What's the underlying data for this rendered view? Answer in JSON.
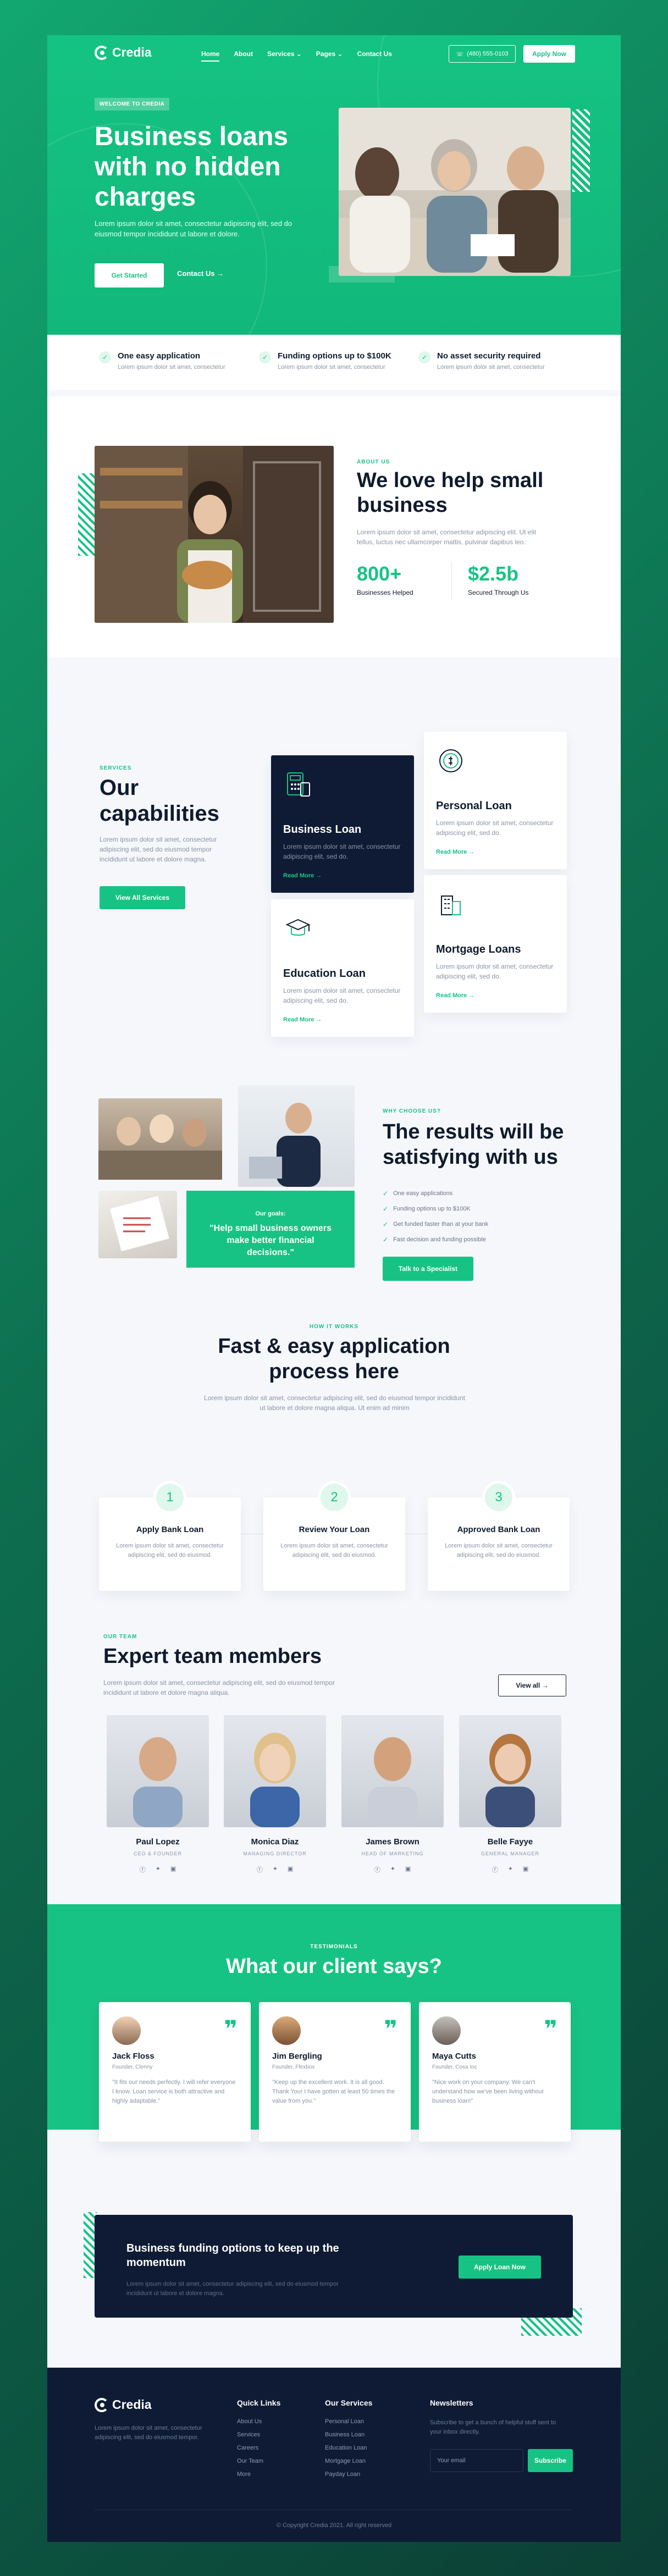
{
  "colors": {
    "brand": "#17c384",
    "dark": "#0f1b34",
    "bg": "#f5f7fb"
  },
  "brand": {
    "name": "Credia"
  },
  "nav": {
    "items": [
      "Home",
      "About",
      "Services",
      "Pages",
      "Contact Us"
    ],
    "active": "Home",
    "phone": "(480) 555-0103",
    "apply": "Apply Now"
  },
  "hero": {
    "badge": "WELCOME TO CREDIA",
    "title": "Business loans with no hidden charges",
    "lead": "Lorem ipsum dolor sit amet, consectetur adipiscing elit, sed do eiusmod tempor incididunt ut labore et dolore.",
    "primary": "Get Started",
    "secondary": "Contact Us"
  },
  "features": [
    {
      "title": "One easy application",
      "text": "Lorem ipsum dolor sit amet, consectetur"
    },
    {
      "title": "Funding options up to $100K",
      "text": "Lorem ipsum dolor sit amet, consectetur"
    },
    {
      "title": "No asset security required",
      "text": "Lorem ipsum dolor sit amet, consectetur"
    }
  ],
  "about": {
    "eyebrow": "ABOUT US",
    "title": "We love help small business",
    "text": "Lorem ipsum dolor sit amet, consectetur adipiscing elit. Ut elit tellus, luctus nec ullamcorper mattis, pulvinar dapibus leo.",
    "stats": [
      {
        "value": "800+",
        "label": "Businesses Helped"
      },
      {
        "value": "$2.5b",
        "label": "Secured Through Us"
      }
    ]
  },
  "capabilities": {
    "eyebrow": "SERVICES",
    "title": "Our capabilities",
    "text": "Lorem ipsum dolor sit amet, consectetur adipiscing elit, sed do eiusmod tempor incididunt ut labore et dolore magna.",
    "button": "View All Services",
    "cards": [
      {
        "title": "Business Loan",
        "text": "Lorem ipsum dolor sit amet, consectetur adipiscing elit, sed do.",
        "link": "Read More",
        "icon": "calculator-icon"
      },
      {
        "title": "Personal Loan",
        "text": "Lorem ipsum dolor sit amet, consectetur adipiscing elit, sed do.",
        "link": "Read More",
        "icon": "coin-icon"
      },
      {
        "title": "Education Loan",
        "text": "Lorem ipsum dolor sit amet, consectetur adipiscing elit, sed do.",
        "link": "Read More",
        "icon": "graduation-icon"
      },
      {
        "title": "Mortgage Loans",
        "text": "Lorem ipsum dolor sit amet, consectetur adipiscing elit, sed do.",
        "link": "Read More",
        "icon": "building-icon"
      }
    ]
  },
  "why": {
    "eyebrow": "WHY CHOOSE US?",
    "title": "The results will be satisfying with us",
    "goals_title": "Our goals:",
    "goals_quote": "\"Help small business owners make better financial decisions.\"",
    "checks": [
      "One easy applications",
      "Funding options up to $100K",
      "Get funded faster than at your bank",
      "Fast decision and funding possible"
    ],
    "button": "Talk to a Specialist"
  },
  "how": {
    "eyebrow": "HOW IT WORKS",
    "title": "Fast & easy application process here",
    "text": "Lorem ipsum dolor sit amet, consectetur adipiscing elit, sed do eiusmod tempor incididunt ut labore et dolore magna aliqua. Ut enim ad minim",
    "steps": [
      {
        "num": "1",
        "title": "Apply Bank Loan",
        "text": "Lorem ipsum dolor sit amet, consectetur adipiscing elit, sed do eiusmod."
      },
      {
        "num": "2",
        "title": "Review Your Loan",
        "text": "Lorem ipsum dolor sit amet, consectetur adipiscing elit, sed do eiusmod."
      },
      {
        "num": "3",
        "title": "Approved Bank Loan",
        "text": "Lorem ipsum dolor sit amet, consectetur adipiscing elit, sed do eiusmod."
      }
    ]
  },
  "team": {
    "eyebrow": "OUR TEAM",
    "title": "Expert team members",
    "text": "Lorem ipsum dolor sit amet, consectetur adipiscing elit, sed do eiusmod tempor incididunt ut labore et dolore magna aliqua.",
    "button": "View all",
    "members": [
      {
        "name": "Paul Lopez",
        "role": "CEO & FOUNDER"
      },
      {
        "name": "Monica Diaz",
        "role": "MANAGING DIRECTOR"
      },
      {
        "name": "James Brown",
        "role": "HEAD OF MARKETING"
      },
      {
        "name": "Belle Fayye",
        "role": "GENERAL MANAGER"
      }
    ]
  },
  "testimonials": {
    "eyebrow": "TESTIMONIALS",
    "title": "What our client says?",
    "items": [
      {
        "name": "Jack Floss",
        "role": "Founder, Clenny",
        "quote": "\"It fits our needs perfectly. I will refer everyone I know. Loan service is both attractive and highly adaptable.\""
      },
      {
        "name": "Jim Bergling",
        "role": "Founder, Flexbox",
        "quote": "\"Keep up the excellent work. It is all good. Thank You! I have gotten at least 50 times the value from you.\""
      },
      {
        "name": "Maya Cutts",
        "role": "Founder, Cosa Inc",
        "quote": "\"Nice work on your company. We can't understand how we've been living without business loan!\""
      }
    ]
  },
  "cta": {
    "title": "Business funding options to keep up the momentum",
    "text": "Lorem ipsum dolor sit amet, consectetur adipiscing elit, sed do eiusmod tempor incididunt ut labore et dolore magna.",
    "button": "Apply Loan Now"
  },
  "footer": {
    "about": "Lorem ipsum dolor sit amet, consectetur adipiscing elit, sed do eiusmod tempor.",
    "quick_title": "Quick Links",
    "quick": [
      "About Us",
      "Services",
      "Careers",
      "Our Team",
      "More"
    ],
    "services_title": "Our Services",
    "services": [
      "Personal Loan",
      "Business Loan",
      "Education Loan",
      "Mortgage Loan",
      "Payday Loan"
    ],
    "newsletter_title": "Newsletters",
    "newsletter_text": "Subscribe to get a bunch of helpful stuff sent to your inbox directly.",
    "email_placeholder": "Your email",
    "subscribe": "Subscribe",
    "copyright": "© Copyright Credia 2021. All right reserved"
  }
}
